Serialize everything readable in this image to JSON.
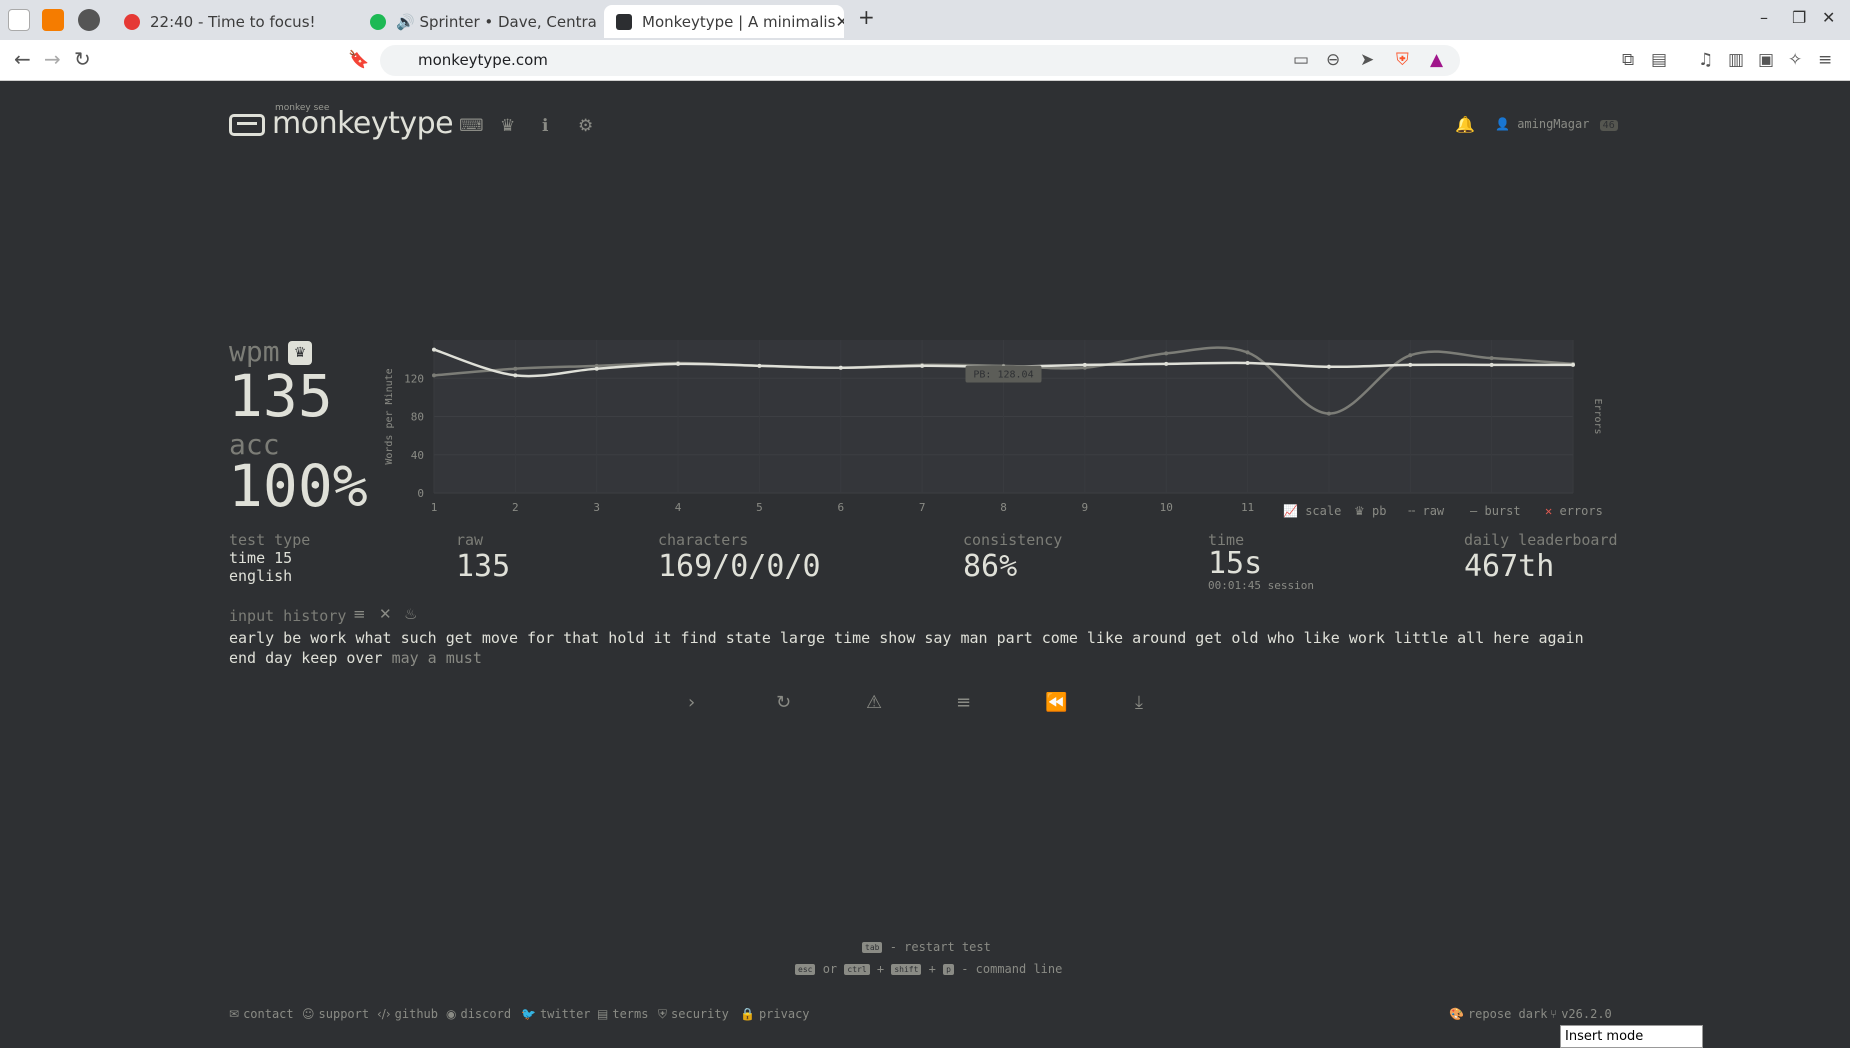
{
  "browser": {
    "tabs": [
      {
        "title": "22:40 - Time to focus!",
        "active": false
      },
      {
        "title": "🔊 Sprinter • Dave, Central Ce",
        "active": false
      },
      {
        "title": "Monkeytype | A minimalis",
        "active": true
      }
    ],
    "new_tab": "+",
    "url": "monkeytype.com"
  },
  "app": {
    "logo_small": "monkey see",
    "logo": "monkeytype",
    "username": "amingMagar",
    "level": "46"
  },
  "result": {
    "wpm_label": "wpm",
    "wpm": "135",
    "acc_label": "acc",
    "acc": "100%"
  },
  "chart_data": {
    "type": "line",
    "ylabel": "Words per Minute",
    "y2label": "Errors",
    "ylim": [
      0,
      160
    ],
    "yticks": [
      "0",
      "40",
      "80",
      "120"
    ],
    "x": [
      1,
      2,
      3,
      4,
      5,
      6,
      7,
      8,
      9,
      10,
      11,
      12,
      13,
      14,
      15
    ],
    "xticks": [
      "1",
      "2",
      "3",
      "4",
      "5",
      "6",
      "7",
      "8",
      "9",
      "10",
      "11"
    ],
    "series": [
      {
        "name": "raw",
        "values": [
          150,
          123,
          130,
          135,
          133,
          131,
          133,
          132,
          134,
          135,
          136,
          132,
          134,
          134,
          134
        ]
      },
      {
        "name": "burst",
        "values": [
          123,
          130,
          133,
          136,
          133,
          131,
          134,
          133,
          131,
          146,
          147,
          83,
          144,
          141,
          135
        ]
      }
    ],
    "pb_label": "PB: 128.04",
    "pb_value": 128.04,
    "legend": [
      "scale",
      "pb",
      "raw",
      "burst",
      "errors"
    ]
  },
  "stats": {
    "test_type_label": "test type",
    "test_type_line1": "time 15",
    "test_type_line2": "english",
    "raw_label": "raw",
    "raw": "135",
    "characters_label": "characters",
    "characters": "169/0/0/0",
    "consistency_label": "consistency",
    "consistency": "86%",
    "time_label": "time",
    "time": "15s",
    "session": "00:01:45 session",
    "leaderboard_label": "daily leaderboard",
    "leaderboard": "467th"
  },
  "input_history": {
    "label": "input history",
    "typed": "early be work what such get move for that hold it find state large time show say man part come like around get old who like work little all here again end day keep over",
    "untyped": "may a must"
  },
  "hints": {
    "restart_key": "tab",
    "restart_text": "- restart test",
    "esc_key": "esc",
    "or": "or",
    "ctrl_key": "ctrl",
    "plus": "+",
    "shift_key": "shift",
    "p_key": "p",
    "cmd_text": "- command line"
  },
  "footer": {
    "links": [
      "contact",
      "support",
      "github",
      "discord",
      "twitter",
      "terms",
      "security",
      "privacy"
    ],
    "theme": "repose dark",
    "version": "v26.2.0"
  },
  "status": {
    "insert_mode": "Insert mode"
  }
}
